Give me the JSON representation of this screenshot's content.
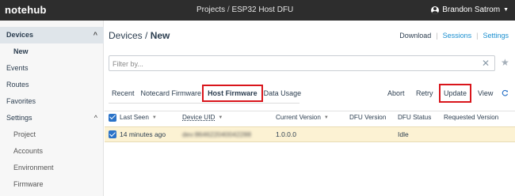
{
  "app": {
    "logo": "notehub",
    "user_name": "Brandon Satrom"
  },
  "breadcrumb": {
    "projects": "Projects",
    "separator": "/",
    "project": "ESP32 Host DFU"
  },
  "sidebar": {
    "items": [
      {
        "label": "Devices",
        "chevron": "^"
      },
      {
        "label": "New"
      },
      {
        "label": "Events"
      },
      {
        "label": "Routes"
      },
      {
        "label": "Favorites"
      },
      {
        "label": "Settings",
        "chevron": "^"
      },
      {
        "label": "Project"
      },
      {
        "label": "Accounts"
      },
      {
        "label": "Environment"
      },
      {
        "label": "Firmware"
      }
    ]
  },
  "header": {
    "title_section": "Devices",
    "title_sep": "/",
    "title_page": "New",
    "links": {
      "download": "Download",
      "sessions": "Sessions",
      "settings": "Settings",
      "pipe": "|"
    }
  },
  "filter": {
    "placeholder": "Filter by...",
    "clear": "✕",
    "star": "★"
  },
  "tabs": [
    "Recent",
    "Notecard Firmware",
    "Host Firmware",
    "Data Usage"
  ],
  "actions": {
    "abort": "Abort",
    "retry": "Retry",
    "update": "Update",
    "view": "View"
  },
  "table": {
    "columns": [
      "Last Seen",
      "Device UID",
      "Current Version",
      "DFU Version",
      "DFU Status",
      "Requested Version"
    ],
    "rows": [
      {
        "last_seen": "14 minutes ago",
        "device_uid": "dev:864622040042288",
        "current_version": "1.0.0.0",
        "dfu_version": "",
        "dfu_status": "Idle",
        "requested_version": ""
      }
    ]
  },
  "colors": {
    "topbar": "#2d2d2d",
    "accent": "#1a8fd0",
    "highlight": "#d9151b",
    "row_selected": "#fcf2d3",
    "checkbox": "#2b73c8"
  }
}
